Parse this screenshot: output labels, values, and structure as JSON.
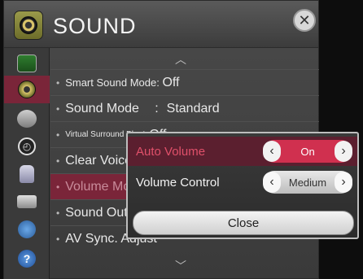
{
  "header": {
    "title": "SOUND",
    "icon": "speaker-icon",
    "close_icon": "close-icon"
  },
  "sidebar": {
    "items": [
      {
        "name": "picture-icon",
        "active": false
      },
      {
        "name": "sound-icon",
        "active": true
      },
      {
        "name": "channel-icon",
        "active": false
      },
      {
        "name": "time-icon",
        "active": false
      },
      {
        "name": "lock-icon",
        "active": false
      },
      {
        "name": "option-icon",
        "active": false
      },
      {
        "name": "network-icon",
        "active": false
      },
      {
        "name": "support-icon",
        "active": false
      }
    ]
  },
  "list": {
    "rows": [
      {
        "label": "Smart Sound Mode",
        "sep": ": ",
        "value": "Off"
      },
      {
        "label": "Sound Mode",
        "sep": ":",
        "value": "Standard"
      },
      {
        "label": "Virtual Surround Plus",
        "sep": ": ",
        "value": "Off"
      },
      {
        "label": "Clear Voice",
        "sep": "",
        "value": ""
      },
      {
        "label": "Volume Mode",
        "sep": "",
        "value": ""
      },
      {
        "label": "Sound Out",
        "sep": "",
        "value": ""
      },
      {
        "label": "AV Sync. Adjust",
        "sep": "",
        "value": ""
      }
    ]
  },
  "popup": {
    "auto_volume": {
      "label": "Auto Volume",
      "value": "On"
    },
    "volume_control": {
      "label": "Volume Control",
      "value": "Medium"
    },
    "close_label": "Close"
  },
  "colors": {
    "accent": "#7a2539",
    "active_row": "#5b1f2f",
    "label_active": "#e0506a"
  }
}
